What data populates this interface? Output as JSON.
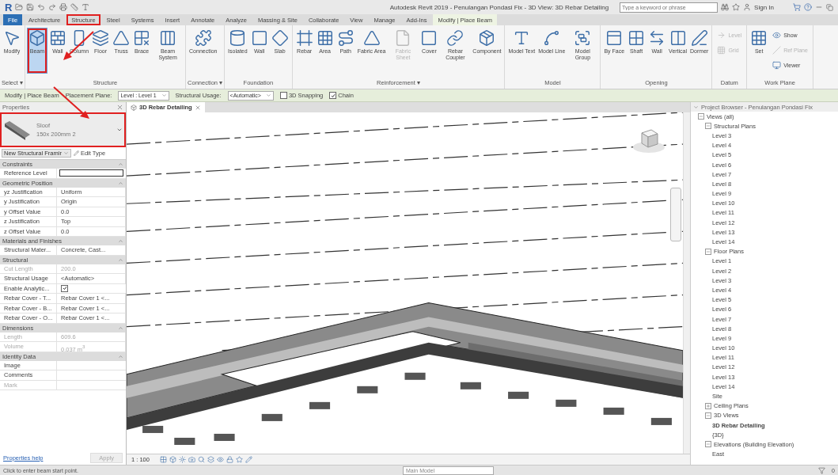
{
  "title_bar": {
    "logo": "R",
    "title": "Autodesk Revit 2019 - Penulangan Pondasi Fix - 3D View: 3D Rebar Detailing",
    "search": {
      "placeholder": "Type a keyword or phrase"
    },
    "sign_in": "Sign In"
  },
  "tabs": [
    {
      "label": "File",
      "kind": "file",
      "selected": false,
      "annotated": false
    },
    {
      "label": "Architecture",
      "kind": "normal",
      "selected": false,
      "annotated": false
    },
    {
      "label": "Structure",
      "kind": "normal",
      "selected": false,
      "annotated": true
    },
    {
      "label": "Steel",
      "kind": "normal",
      "selected": false,
      "annotated": false
    },
    {
      "label": "Systems",
      "kind": "normal",
      "selected": false,
      "annotated": false
    },
    {
      "label": "Insert",
      "kind": "normal",
      "selected": false,
      "annotated": false
    },
    {
      "label": "Annotate",
      "kind": "normal",
      "selected": false,
      "annotated": false
    },
    {
      "label": "Analyze",
      "kind": "normal",
      "selected": false,
      "annotated": false
    },
    {
      "label": "Massing & Site",
      "kind": "normal",
      "selected": false,
      "annotated": false
    },
    {
      "label": "Collaborate",
      "kind": "normal",
      "selected": false,
      "annotated": false
    },
    {
      "label": "View",
      "kind": "normal",
      "selected": false,
      "annotated": false
    },
    {
      "label": "Manage",
      "kind": "normal",
      "selected": false,
      "annotated": false
    },
    {
      "label": "Add-Ins",
      "kind": "normal",
      "selected": false,
      "annotated": false
    },
    {
      "label": "Modify | Place Beam",
      "kind": "contextual",
      "selected": true,
      "annotated": false
    }
  ],
  "ribbon": [
    {
      "label": "Select ▾",
      "tools": [
        {
          "label": "Modify",
          "kind": "large",
          "selected": false,
          "disabled": false,
          "annotated": false
        }
      ]
    },
    {
      "label": "Structure",
      "tools": [
        {
          "label": "Beam",
          "kind": "large",
          "selected": true,
          "disabled": false,
          "annotated": true
        },
        {
          "label": "Wall",
          "kind": "large",
          "selected": false,
          "disabled": false,
          "annotated": false
        },
        {
          "label": "Column",
          "kind": "large",
          "selected": false,
          "disabled": false,
          "annotated": false
        },
        {
          "label": "Floor",
          "kind": "large",
          "selected": false,
          "disabled": false,
          "annotated": false
        },
        {
          "label": "Truss",
          "kind": "large",
          "selected": false,
          "disabled": false,
          "annotated": false
        },
        {
          "label": "Brace",
          "kind": "large",
          "selected": false,
          "disabled": false,
          "annotated": false
        },
        {
          "label": "Beam System",
          "kind": "large",
          "selected": false,
          "disabled": false,
          "annotated": false
        }
      ]
    },
    {
      "label": "Connection ▾",
      "tools": [
        {
          "label": "Connection",
          "kind": "large",
          "selected": false,
          "disabled": false,
          "annotated": false
        }
      ]
    },
    {
      "label": "Foundation",
      "tools": [
        {
          "label": "Isolated",
          "kind": "large",
          "selected": false,
          "disabled": false,
          "annotated": false
        },
        {
          "label": "Wall",
          "kind": "large",
          "selected": false,
          "disabled": false,
          "annotated": false
        },
        {
          "label": "Slab",
          "kind": "large",
          "selected": false,
          "disabled": false,
          "annotated": false
        }
      ]
    },
    {
      "label": "Reinforcement ▾",
      "tools": [
        {
          "label": "Rebar",
          "kind": "large",
          "selected": false,
          "disabled": false,
          "annotated": false
        },
        {
          "label": "Area",
          "kind": "large",
          "selected": false,
          "disabled": false,
          "annotated": false
        },
        {
          "label": "Path",
          "kind": "large",
          "selected": false,
          "disabled": false,
          "annotated": false
        },
        {
          "label": "Fabric Area",
          "kind": "large",
          "selected": false,
          "disabled": false,
          "annotated": false
        },
        {
          "label": "Fabric Sheet",
          "kind": "large",
          "selected": false,
          "disabled": true,
          "annotated": false
        },
        {
          "label": "Cover",
          "kind": "large",
          "selected": false,
          "disabled": false,
          "annotated": false
        },
        {
          "label": "Rebar Coupler",
          "kind": "large",
          "selected": false,
          "disabled": false,
          "annotated": false
        },
        {
          "label": "Component",
          "kind": "large",
          "selected": false,
          "disabled": false,
          "annotated": false
        }
      ]
    },
    {
      "label": "Model",
      "tools": [
        {
          "label": "Model Text",
          "kind": "large",
          "selected": false,
          "disabled": false,
          "annotated": false
        },
        {
          "label": "Model Line",
          "kind": "large",
          "selected": false,
          "disabled": false,
          "annotated": false
        },
        {
          "label": "Model Group",
          "kind": "large",
          "selected": false,
          "disabled": false,
          "annotated": false
        }
      ]
    },
    {
      "label": "Opening",
      "tools": [
        {
          "label": "By Face",
          "kind": "large",
          "selected": false,
          "disabled": false,
          "annotated": false
        },
        {
          "label": "Shaft",
          "kind": "large",
          "selected": false,
          "disabled": false,
          "annotated": false
        },
        {
          "label": "Wall",
          "kind": "large",
          "selected": false,
          "disabled": false,
          "annotated": false
        },
        {
          "label": "Vertical",
          "kind": "large",
          "selected": false,
          "disabled": false,
          "annotated": false
        },
        {
          "label": "Dormer",
          "kind": "large",
          "selected": false,
          "disabled": false,
          "annotated": false
        }
      ]
    },
    {
      "label": "Datum",
      "tools": [
        {
          "label": "Level",
          "kind": "small",
          "selected": false,
          "disabled": true,
          "annotated": false
        },
        {
          "label": "Grid",
          "kind": "small",
          "selected": false,
          "disabled": true,
          "annotated": false
        }
      ]
    },
    {
      "label": "Work Plane",
      "tools": [
        {
          "label": "Set",
          "kind": "large",
          "selected": false,
          "disabled": false,
          "annotated": false
        },
        {
          "label": "Show",
          "kind": "small",
          "selected": false,
          "disabled": false,
          "annotated": false
        },
        {
          "label": "Ref Plane",
          "kind": "small",
          "selected": false,
          "disabled": true,
          "annotated": false
        },
        {
          "label": "Viewer",
          "kind": "small",
          "selected": false,
          "disabled": false,
          "annotated": false
        }
      ]
    }
  ],
  "options_bar": {
    "context": "Modify | Place Beam",
    "placement_label": "Placement Plane:",
    "placement_value": "Level : Level 1",
    "usage_label": "Structural Usage:",
    "usage_value": "<Automatic>",
    "checks": [
      {
        "label": "3D Snapping",
        "checked": false
      },
      {
        "label": "Chain",
        "checked": true
      }
    ]
  },
  "properties": {
    "title": "Properties",
    "type_family": "Sloof",
    "type_name": "150x 200mm 2",
    "annotated": true,
    "instance_filter": "New Structural Framir",
    "edit_type": "Edit Type",
    "sections": [
      {
        "title": "Constraints",
        "rows": [
          {
            "label": "Reference Level",
            "kind": "field",
            "disabled": false
          }
        ]
      },
      {
        "title": "Geometric Position",
        "rows": [
          {
            "label": "yz Justification",
            "value": "Uniform",
            "kind": "text",
            "disabled": false
          },
          {
            "label": "y Justification",
            "value": "Origin",
            "kind": "text",
            "disabled": false
          },
          {
            "label": "y Offset Value",
            "value": "0.0",
            "kind": "text",
            "disabled": false
          },
          {
            "label": "z Justification",
            "value": "Top",
            "kind": "text",
            "disabled": false
          },
          {
            "label": "z Offset Value",
            "value": "0.0",
            "kind": "text",
            "disabled": false
          }
        ]
      },
      {
        "title": "Materials and Finishes",
        "rows": [
          {
            "label": "Structural Mater...",
            "value": "Concrete, Cast...",
            "kind": "text",
            "disabled": false
          }
        ]
      },
      {
        "title": "Structural",
        "rows": [
          {
            "label": "Cut Length",
            "value": "200.0",
            "kind": "text",
            "disabled": true
          },
          {
            "label": "Structural Usage",
            "value": "<Automatic>",
            "kind": "text",
            "disabled": false
          },
          {
            "label": "Enable Analytic...",
            "kind": "check",
            "checked": true,
            "disabled": false
          },
          {
            "label": "Rebar Cover - T...",
            "value": "Rebar Cover 1 <...",
            "kind": "text",
            "disabled": false
          },
          {
            "label": "Rebar Cover - B...",
            "value": "Rebar Cover 1 <...",
            "kind": "text",
            "disabled": false
          },
          {
            "label": "Rebar Cover - O...",
            "value": "Rebar Cover 1 <...",
            "kind": "text",
            "disabled": false
          }
        ]
      },
      {
        "title": "Dimensions",
        "rows": [
          {
            "label": "Length",
            "value": "609.6",
            "kind": "text",
            "disabled": true
          },
          {
            "label": "Volume",
            "value": "0.037 m$^{3}$",
            "kind": "text",
            "disabled": true
          }
        ]
      },
      {
        "title": "Identity Data",
        "rows": [
          {
            "label": "Image",
            "kind": "text",
            "disabled": false
          },
          {
            "label": "Comments",
            "kind": "text",
            "disabled": false
          },
          {
            "label": "Mark",
            "kind": "text",
            "disabled": true
          }
        ]
      }
    ],
    "help_link": "Properties help",
    "apply": "Apply"
  },
  "view": {
    "tabs": [
      {
        "label": "3D Rebar Detailing",
        "selected": true
      }
    ],
    "scale": "1 : 100"
  },
  "project_browser": {
    "title": "Project Browser - Penulangan Pondasi Fix",
    "tree": [
      {
        "label": "Views (all)",
        "expanded": true,
        "selected": false,
        "children": [
          {
            "label": "Structural Plans",
            "expanded": true,
            "selected": false,
            "children": [
              {
                "label": "Level 3",
                "selected": false
              },
              {
                "label": "Level 4",
                "selected": false
              },
              {
                "label": "Level 5",
                "selected": false
              },
              {
                "label": "Level 6",
                "selected": false
              },
              {
                "label": "Level 7",
                "selected": false
              },
              {
                "label": "Level 8",
                "selected": false
              },
              {
                "label": "Level 9",
                "selected": false
              },
              {
                "label": "Level 10",
                "selected": false
              },
              {
                "label": "Level 11",
                "selected": false
              },
              {
                "label": "Level 12",
                "selected": false
              },
              {
                "label": "Level 13",
                "selected": false
              },
              {
                "label": "Level 14",
                "selected": false
              }
            ]
          },
          {
            "label": "Floor Plans",
            "expanded": true,
            "selected": false,
            "children": [
              {
                "label": "Level 1",
                "selected": false
              },
              {
                "label": "Level 2",
                "selected": false
              },
              {
                "label": "Level 3",
                "selected": false
              },
              {
                "label": "Level 4",
                "selected": false
              },
              {
                "label": "Level 5",
                "selected": false
              },
              {
                "label": "Level 6",
                "selected": false
              },
              {
                "label": "Level 7",
                "selected": false
              },
              {
                "label": "Level 8",
                "selected": false
              },
              {
                "label": "Level 9",
                "selected": false
              },
              {
                "label": "Level 10",
                "selected": false
              },
              {
                "label": "Level 11",
                "selected": false
              },
              {
                "label": "Level 12",
                "selected": false
              },
              {
                "label": "Level 13",
                "selected": false
              },
              {
                "label": "Level 14",
                "selected": false
              },
              {
                "label": "Site",
                "selected": false
              }
            ]
          },
          {
            "label": "Ceiling Plans",
            "expanded": false,
            "selected": false
          },
          {
            "label": "3D Views",
            "expanded": true,
            "selected": false,
            "children": [
              {
                "label": "3D Rebar Detailing",
                "selected": true
              },
              {
                "label": "{3D}",
                "selected": false
              }
            ]
          },
          {
            "label": "Elevations (Building Elevation)",
            "expanded": true,
            "selected": false,
            "children": [
              {
                "label": "East",
                "selected": false
              }
            ]
          }
        ]
      }
    ]
  },
  "status_bar": {
    "message": "Click to enter beam start point.",
    "model": "Main Model",
    "filter_count": "0"
  }
}
